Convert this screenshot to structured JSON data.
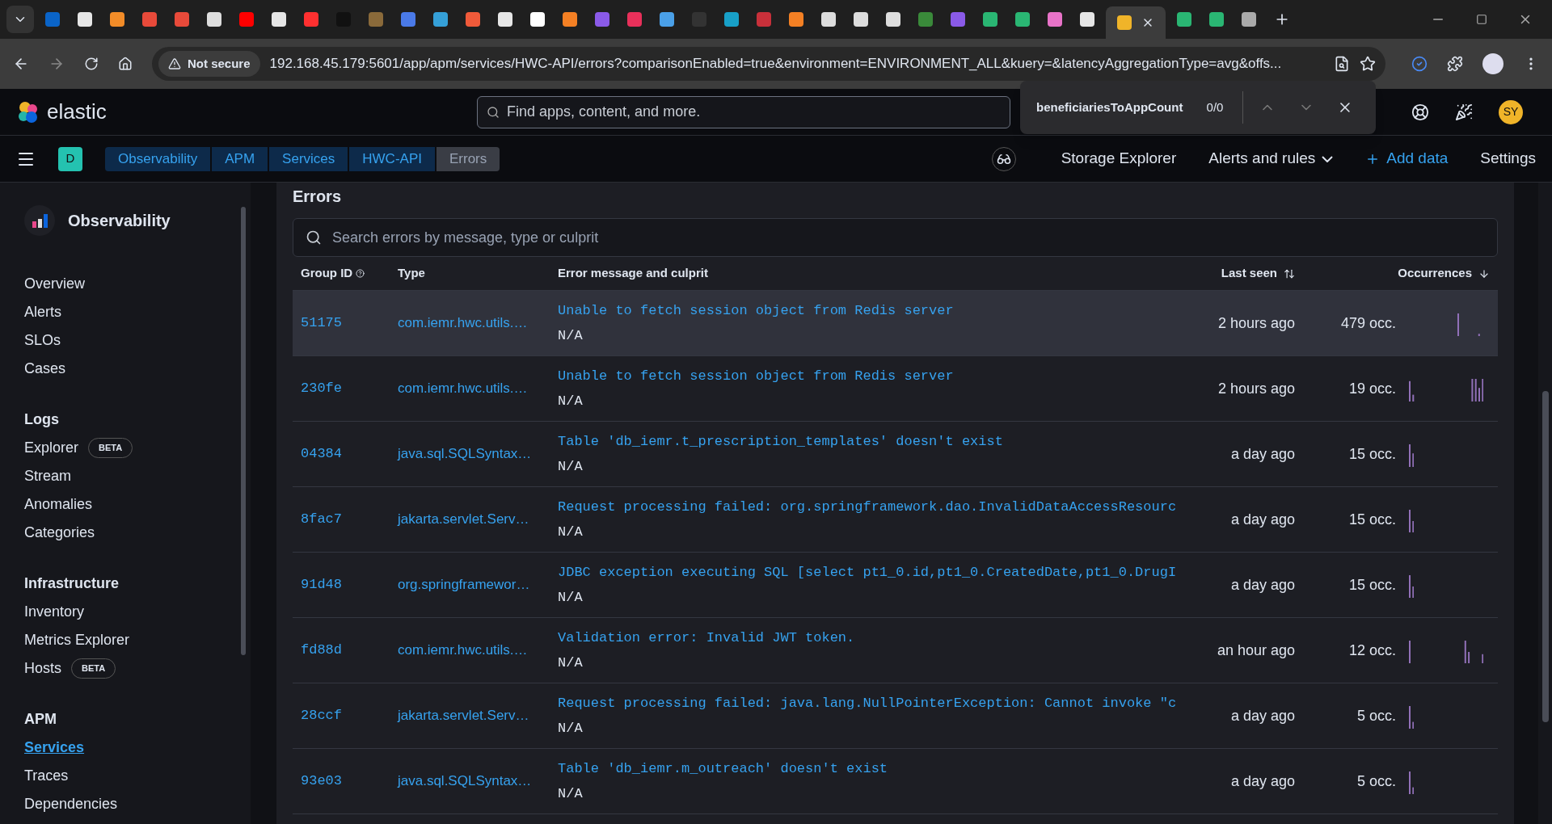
{
  "browser": {
    "tabs": [
      {
        "color": "#0a64c8",
        "selected": false
      },
      {
        "color": "#e6e6e6",
        "selected": false
      },
      {
        "color": "#f28c28",
        "selected": false
      },
      {
        "color": "#e84a3a",
        "selected": false
      },
      {
        "color": "#e84a3a",
        "selected": false
      },
      {
        "color": "#dddddd",
        "selected": false
      },
      {
        "color": "#ff0000",
        "selected": false
      },
      {
        "color": "#e6e6e6",
        "selected": false
      },
      {
        "color": "#ff3030",
        "selected": false
      },
      {
        "color": "#111111",
        "selected": false
      },
      {
        "color": "#8a6a3a",
        "selected": false
      },
      {
        "color": "#4a7ae8",
        "selected": false
      },
      {
        "color": "#35a0d8",
        "selected": false
      },
      {
        "color": "#f05a3a",
        "selected": false
      },
      {
        "color": "#e6e6e6",
        "selected": false
      },
      {
        "color": "#ffffff",
        "selected": false
      },
      {
        "color": "#f48024",
        "selected": false
      },
      {
        "color": "#8a5ae8",
        "selected": false
      },
      {
        "color": "#e8305a",
        "selected": false
      },
      {
        "color": "#4aa0e8",
        "selected": false
      },
      {
        "color": "#333333",
        "selected": false
      },
      {
        "color": "#18a0c8",
        "selected": false
      },
      {
        "color": "#c8303a",
        "selected": false
      },
      {
        "color": "#f48024",
        "selected": false
      },
      {
        "color": "#dddddd",
        "selected": false
      },
      {
        "color": "#dddddd",
        "selected": false
      },
      {
        "color": "#dddddd",
        "selected": false
      },
      {
        "color": "#3a8a3a",
        "selected": false
      },
      {
        "color": "#8a5ae8",
        "selected": false
      },
      {
        "color": "#2ab673",
        "selected": false
      },
      {
        "color": "#2ab673",
        "selected": false
      },
      {
        "color": "#e873c8",
        "selected": false
      },
      {
        "color": "#e6e6e6",
        "selected": false
      },
      {
        "color": "#f0b429",
        "selected": true
      },
      {
        "color": "#2ab673",
        "selected": false
      },
      {
        "color": "#2ab673",
        "selected": false
      },
      {
        "color": "#aaaaaa",
        "selected": false
      }
    ],
    "security": "Not secure",
    "url": "192.168.45.179:5601/app/apm/services/HWC-API/errors?comparisonEnabled=true&environment=ENVIRONMENT_ALL&kuery=&latencyAggregationType=avg&offs..."
  },
  "header": {
    "logo": "elastic",
    "search": {
      "placeholder": "Find apps, content, and more."
    },
    "avatar": "SY"
  },
  "find_bar": {
    "query": "beneficiariesToAppCount",
    "count": "0/0"
  },
  "breadcrumbs": {
    "space": "D",
    "items": [
      {
        "label": "Observability",
        "selected": false
      },
      {
        "label": "APM",
        "selected": false
      },
      {
        "label": "Services",
        "selected": false
      },
      {
        "label": "HWC-API",
        "selected": false
      },
      {
        "label": "Errors",
        "selected": true
      }
    ]
  },
  "toolbar": {
    "links": [
      "Storage Explorer",
      "Alerts and rules",
      "Add data",
      "Settings"
    ]
  },
  "sidebar": {
    "title": "Observability",
    "sections": [
      {
        "items": [
          {
            "label": "Overview",
            "selected": false
          },
          {
            "label": "Alerts",
            "selected": false
          },
          {
            "label": "SLOs",
            "selected": false
          },
          {
            "label": "Cases",
            "selected": false
          }
        ]
      },
      {
        "heading": "Logs",
        "items": [
          {
            "label": "Explorer",
            "badge": "BETA",
            "selected": false
          },
          {
            "label": "Stream",
            "selected": false
          },
          {
            "label": "Anomalies",
            "selected": false
          },
          {
            "label": "Categories",
            "selected": false
          }
        ]
      },
      {
        "heading": "Infrastructure",
        "items": [
          {
            "label": "Inventory",
            "selected": false
          },
          {
            "label": "Metrics Explorer",
            "selected": false
          },
          {
            "label": "Hosts",
            "badge": "BETA",
            "selected": false
          }
        ]
      },
      {
        "heading": "APM",
        "items": [
          {
            "label": "Services",
            "selected": true
          },
          {
            "label": "Traces",
            "selected": false
          },
          {
            "label": "Dependencies",
            "selected": false
          }
        ]
      }
    ]
  },
  "errors": {
    "title": "Errors",
    "search": {
      "placeholder": "Search errors by message, type or culprit"
    },
    "columns": [
      "Group ID",
      "Type",
      "Error message and culprit",
      "Last seen",
      "Occurrences"
    ],
    "rows": [
      {
        "group_id": "51175",
        "type": "com.iemr.hwc.utils.…",
        "message": "Unable to fetch session object from Redis server",
        "culprit": "N/A",
        "last_seen": "2 hours ago",
        "occurrences": "479 occ.",
        "selected": true
      },
      {
        "group_id": "230fe",
        "type": "com.iemr.hwc.utils.…",
        "message": "Unable to fetch session object from Redis server",
        "culprit": "N/A",
        "last_seen": "2 hours ago",
        "occurrences": "19 occ.",
        "selected": false
      },
      {
        "group_id": "04384",
        "type": "java.sql.SQLSyntax…",
        "message": "Table 'db_iemr.t_prescription_templates' doesn't exist",
        "culprit": "N/A",
        "last_seen": "a day ago",
        "occurrences": "15 occ.",
        "selected": false
      },
      {
        "group_id": "8fac7",
        "type": "jakarta.servlet.Serv…",
        "message": "Request processing failed: org.springframework.dao.InvalidDataAccessResourc",
        "culprit": "N/A",
        "last_seen": "a day ago",
        "occurrences": "15 occ.",
        "selected": false
      },
      {
        "group_id": "91d48",
        "type": "org.springframewor…",
        "message": "JDBC exception executing SQL [select pt1_0.id,pt1_0.CreatedDate,pt1_0.DrugI",
        "culprit": "N/A",
        "last_seen": "a day ago",
        "occurrences": "15 occ.",
        "selected": false
      },
      {
        "group_id": "fd88d",
        "type": "com.iemr.hwc.utils.…",
        "message": "Validation error: Invalid JWT token.",
        "culprit": "N/A",
        "last_seen": "an hour ago",
        "occurrences": "12 occ.",
        "selected": false
      },
      {
        "group_id": "28ccf",
        "type": "jakarta.servlet.Serv…",
        "message": "Request processing failed: java.lang.NullPointerException: Cannot invoke \"c",
        "culprit": "N/A",
        "last_seen": "a day ago",
        "occurrences": "5 occ.",
        "selected": false
      },
      {
        "group_id": "93e03",
        "type": "java.sql.SQLSyntax…",
        "message": "Table 'db_iemr.m_outreach' doesn't exist",
        "culprit": "N/A",
        "last_seen": "a day ago",
        "occurrences": "5 occ.",
        "selected": false
      }
    ]
  }
}
